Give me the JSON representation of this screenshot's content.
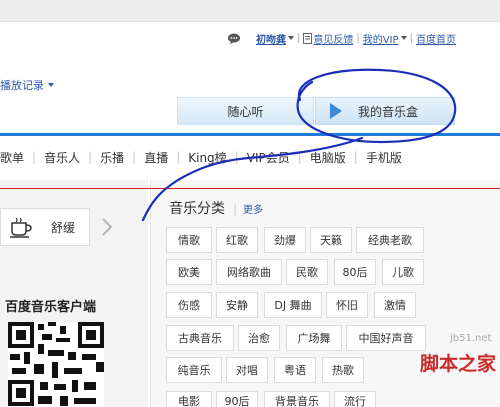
{
  "top_links": {
    "feedback_icon": "chat-bubble-icon",
    "user": "初吻龚",
    "feedback": "意见反馈",
    "vip": "我的VIP",
    "baidu_home": "百度首页",
    "separator": "|"
  },
  "history": {
    "label": "播放记录"
  },
  "player_buttons": {
    "listen": "随心听",
    "music_box": "我的音乐盒"
  },
  "nav": {
    "separator": "|",
    "items": [
      "歌单",
      "音乐人",
      "乐播",
      "直播",
      "King榜",
      "VIP会员",
      "电脑版",
      "手机版"
    ]
  },
  "left": {
    "mood_label": "舒缓",
    "client_title": "百度音乐客户端"
  },
  "category": {
    "title": "音乐分类",
    "separator": "|",
    "more": "更多",
    "rows": [
      [
        "情歌",
        "红歌",
        "劲爆",
        "天籁",
        "经典老歌"
      ],
      [
        "欧美",
        "网络歌曲",
        "民歌",
        "80后",
        "儿歌"
      ],
      [
        "伤感",
        "安静",
        "DJ 舞曲",
        "怀旧",
        "激情"
      ],
      [
        "古典音乐",
        "治愈",
        "广场舞",
        "中国好声音"
      ],
      [
        "纯音乐",
        "对唱",
        "粤语",
        "热歌"
      ],
      [
        "电影",
        "90后",
        "背景音乐",
        "流行"
      ]
    ]
  },
  "watermark": {
    "url": "jb51.net",
    "name": "脚本之家"
  },
  "colors": {
    "nav_bar": "#1f7ad8",
    "link": "#2b5aa8",
    "scribble": "#1a2eb8",
    "red_line": "#e02020"
  }
}
